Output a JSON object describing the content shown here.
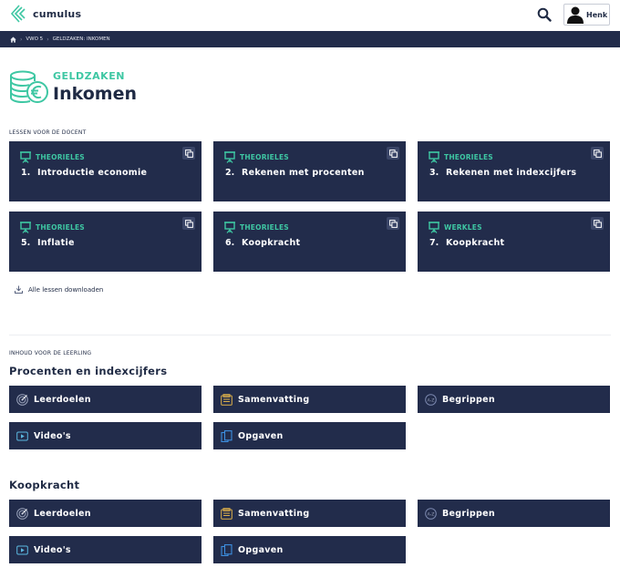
{
  "header": {
    "brand": "cumulus",
    "user_name": "Henk",
    "icons": [
      "cumulus-logo-icon",
      "search-icon",
      "user-avatar-icon"
    ]
  },
  "breadcrumb": {
    "items": [
      "VWO 5",
      "GELDZAKEN: INKOMEN"
    ]
  },
  "page": {
    "subject": "GELDZAKEN",
    "title": "Inkomen"
  },
  "teacher": {
    "section_label": "LESSEN VOOR DE DOCENT",
    "lessons": [
      {
        "type": "THEORIELES",
        "number": "1.",
        "title": "Introductie economie"
      },
      {
        "type": "THEORIELES",
        "number": "2.",
        "title": "Rekenen met procenten"
      },
      {
        "type": "THEORIELES",
        "number": "3.",
        "title": "Rekenen met indexcijfers"
      },
      {
        "type": "THEORIELES",
        "number": "5.",
        "title": "Inflatie"
      },
      {
        "type": "THEORIELES",
        "number": "6.",
        "title": "Koopkracht"
      },
      {
        "type": "WERKLES",
        "number": "7.",
        "title": "Koopkracht"
      }
    ],
    "download_label": "Alle lessen downloaden"
  },
  "student": {
    "section_label": "INHOUD VOOR DE LEERLING",
    "groups": [
      {
        "title": "Procenten en indexcijfers",
        "tiles": [
          {
            "label": "Leerdoelen",
            "icon": "target-icon"
          },
          {
            "label": "Samenvatting",
            "icon": "summary-icon"
          },
          {
            "label": "Begrippen",
            "icon": "a-z-icon"
          },
          {
            "label": "Video's",
            "icon": "video-icon"
          },
          {
            "label": "Opgaven",
            "icon": "exercises-icon"
          }
        ]
      },
      {
        "title": "Koopkracht",
        "tiles": [
          {
            "label": "Leerdoelen",
            "icon": "target-icon"
          },
          {
            "label": "Samenvatting",
            "icon": "summary-icon"
          },
          {
            "label": "Begrippen",
            "icon": "a-z-icon"
          },
          {
            "label": "Video's",
            "icon": "video-icon"
          },
          {
            "label": "Opgaven",
            "icon": "exercises-icon"
          }
        ]
      }
    ]
  },
  "colors": {
    "navy": "#222c4b",
    "accent": "#3ec7a3",
    "text": "#1f2a44"
  }
}
